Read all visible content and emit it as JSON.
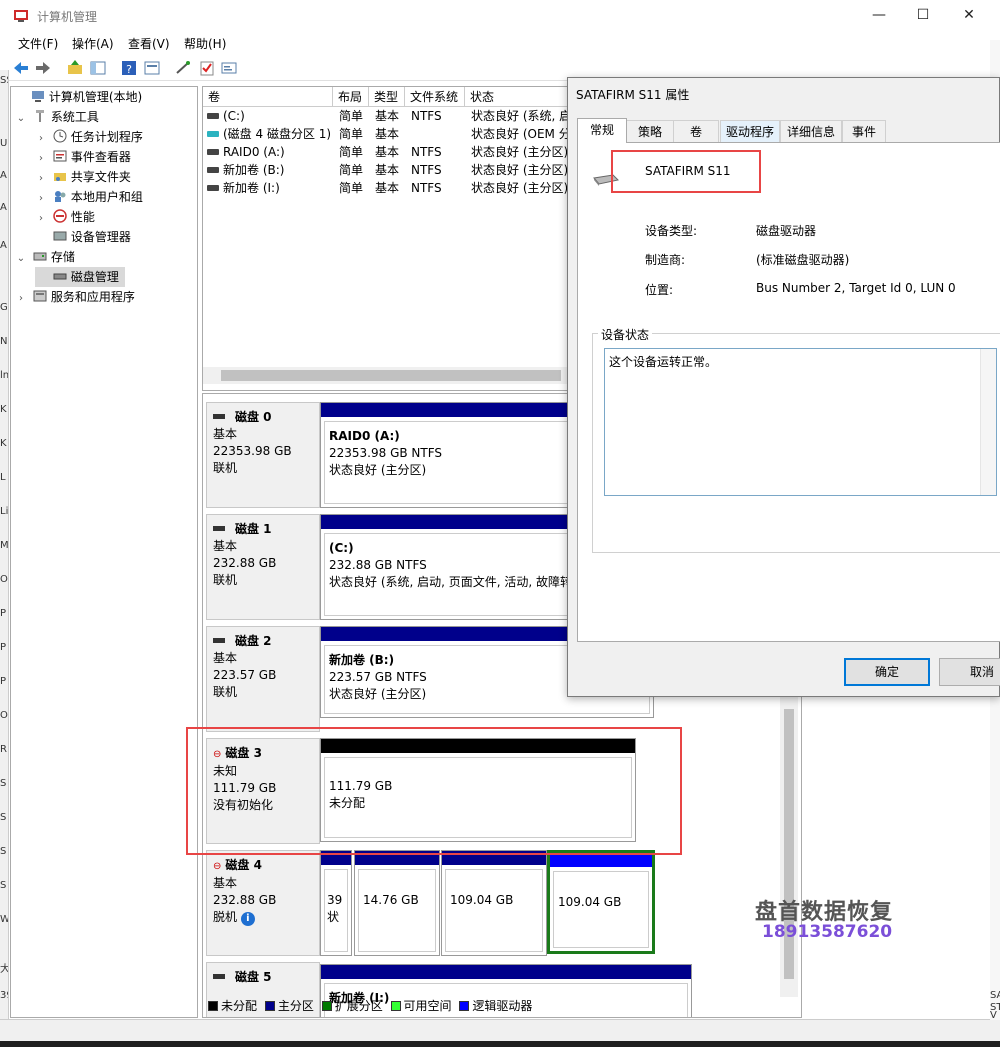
{
  "window": {
    "title": "计算机管理",
    "minimize": "—",
    "maximize": "☐",
    "close": "✕"
  },
  "menu": {
    "items": [
      "文件(F)",
      "操作(A)",
      "查看(V)",
      "帮助(H)"
    ]
  },
  "left_sliver": [
    "SS",
    "U",
    "A",
    "A",
    "A",
    "G",
    "N",
    "ln",
    "K",
    "K",
    "L",
    "Li",
    "M",
    "O",
    "P",
    "P",
    "P",
    "O",
    "R",
    "S",
    "S",
    "S",
    "S",
    "W",
    "大",
    "39"
  ],
  "tree": {
    "root": "计算机管理(本地)",
    "system_tools": "系统工具",
    "task_scheduler": "任务计划程序",
    "event_viewer": "事件查看器",
    "shared_folders": "共享文件夹",
    "local_users": "本地用户和组",
    "performance": "性能",
    "device_manager": "设备管理器",
    "storage": "存储",
    "disk_management": "磁盘管理",
    "services": "服务和应用程序"
  },
  "volumes": {
    "headers": [
      "卷",
      "布局",
      "类型",
      "文件系统",
      "状态"
    ],
    "rows": [
      {
        "name": "(C:)",
        "layout": "简单",
        "type": "基本",
        "fs": "NTFS",
        "status": "状态良好 (系统, 启"
      },
      {
        "name": "(磁盘 4 磁盘分区 1)",
        "layout": "简单",
        "type": "基本",
        "fs": "",
        "status": "状态良好 (OEM 分"
      },
      {
        "name": "RAID0 (A:)",
        "layout": "简单",
        "type": "基本",
        "fs": "NTFS",
        "status": "状态良好 (主分区)"
      },
      {
        "name": "新加卷 (B:)",
        "layout": "简单",
        "type": "基本",
        "fs": "NTFS",
        "status": "状态良好 (主分区)"
      },
      {
        "name": "新加卷 (I:)",
        "layout": "简单",
        "type": "基本",
        "fs": "NTFS",
        "status": "状态良好 (主分区)"
      }
    ]
  },
  "disks": [
    {
      "name": "磁盘 0",
      "type": "基本",
      "size": "22353.98 GB",
      "state": "联机",
      "part_title": "RAID0  (A:)",
      "part_size": "22353.98 GB NTFS",
      "part_status": "状态良好 (主分区)"
    },
    {
      "name": "磁盘 1",
      "type": "基本",
      "size": "232.88 GB",
      "state": "联机",
      "part_title": " (C:)",
      "part_size": "232.88 GB NTFS",
      "part_status": "状态良好 (系统, 启动, 页面文件, 活动, 故障转"
    },
    {
      "name": "磁盘 2",
      "type": "基本",
      "size": "223.57 GB",
      "state": "联机",
      "part_title": "新加卷  (B:)",
      "part_size": "223.57 GB NTFS",
      "part_status": "状态良好 (主分区)"
    },
    {
      "name": "磁盘 3",
      "type": "未知",
      "size": "111.79 GB",
      "state": "没有初始化",
      "part_title": "",
      "part_size": "111.79 GB",
      "part_status": "未分配"
    },
    {
      "name": "磁盘 4",
      "type": "基本",
      "size": "232.88 GB",
      "state": "脱机",
      "parts": [
        "39",
        "14.76 GB",
        "109.04 GB",
        "109.04 GB"
      ],
      "part0_sub": "状"
    },
    {
      "name": "磁盘 5",
      "part_title": "新加卷  (I:)"
    }
  ],
  "legend": {
    "items": [
      {
        "label": "未分配",
        "color": "#000000"
      },
      {
        "label": "主分区",
        "color": "#00008b"
      },
      {
        "label": "扩展分区",
        "color": "#007a00"
      },
      {
        "label": "可用空间",
        "color": "#33ff33"
      },
      {
        "label": "逻辑驱动器",
        "color": "#0000ff"
      }
    ]
  },
  "dialog": {
    "title": "SATAFIRM   S11 属性",
    "tabs": [
      "常规",
      "策略",
      "卷",
      "驱动程序",
      "详细信息",
      "事件"
    ],
    "device_name": "SATAFIRM   S11",
    "device_type_label": "设备类型:",
    "device_type_value": "磁盘驱动器",
    "manufacturer_label": "制造商:",
    "manufacturer_value": "(标准磁盘驱动器)",
    "location_label": "位置:",
    "location_value": "Bus Number 2, Target Id 0, LUN 0",
    "status_group_label": "设备状态",
    "status_text": "这个设备运转正常。",
    "ok": "确定",
    "cancel": "取消"
  },
  "watermark": {
    "name": "盘首数据恢复",
    "phone": "18913587620"
  },
  "right_strip": [
    "SA",
    "ST",
    "V",
    "D"
  ]
}
